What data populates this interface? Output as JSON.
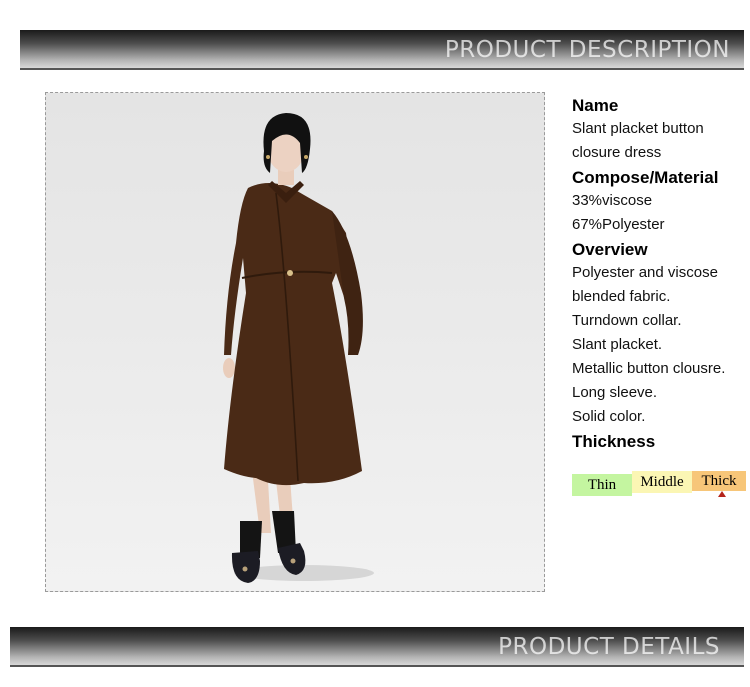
{
  "banners": {
    "top_title": "PRODUCT DESCRIPTION",
    "bottom_title": "PRODUCT DETAILS"
  },
  "product": {
    "name_heading": "Name",
    "name_lines": [
      "Slant placket button",
      "closure dress"
    ],
    "material_heading": "Compose/Material",
    "material_lines": [
      "33%viscose",
      "67%Polyester"
    ],
    "overview_heading": "Overview",
    "overview_lines": [
      "Polyester and viscose",
      "blended fabric.",
      "Turndown collar.",
      "Slant placket.",
      "Metallic button clousre.",
      "Long sleeve.",
      "Solid color."
    ],
    "thickness_heading": "Thickness",
    "thickness_options": [
      "Thin",
      "Middle",
      "Thick"
    ],
    "thickness_selected": "Thick"
  },
  "colors": {
    "banner_dark": "#1a1a1a",
    "thin": "#c4f5a0",
    "middle": "#fbf6b4",
    "thick": "#f7c679",
    "marker": "#b5231a",
    "dress": "#4a2a16"
  },
  "image": {
    "subject": "model-wearing-brown-dress"
  }
}
